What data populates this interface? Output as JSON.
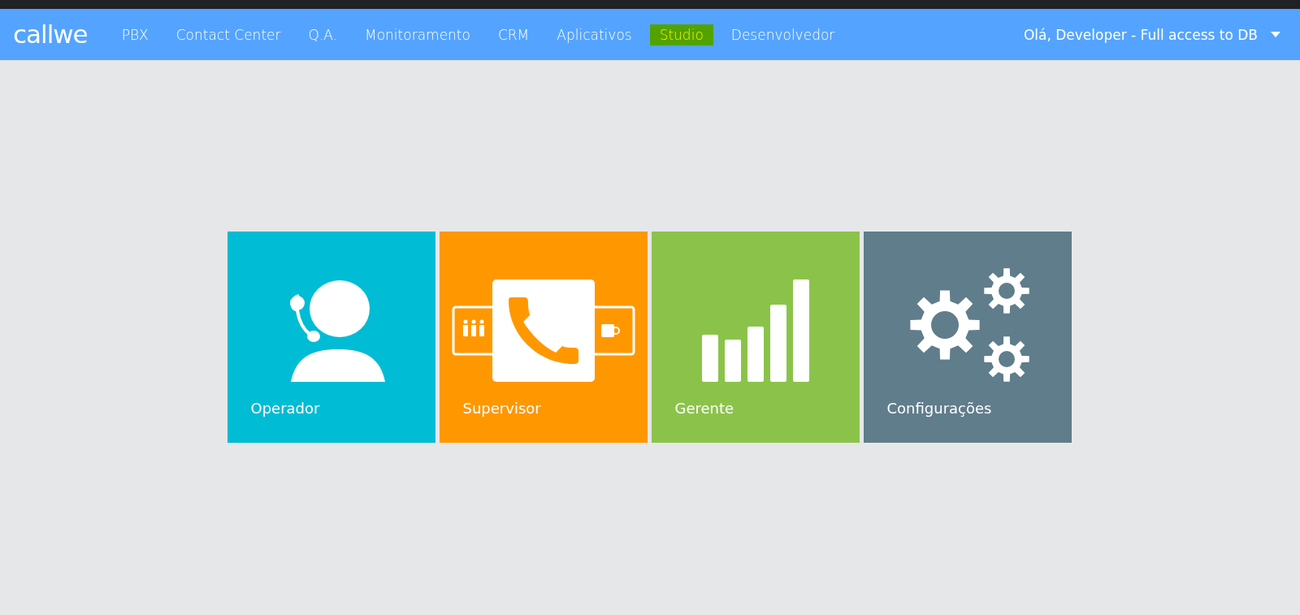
{
  "navbar": {
    "logo": "callwe",
    "items": [
      {
        "label": "PBX",
        "selected": false
      },
      {
        "label": "Contact Center",
        "selected": false
      },
      {
        "label": "Q.A.",
        "selected": false
      },
      {
        "label": "Monitoramento",
        "selected": false
      },
      {
        "label": "CRM",
        "selected": false
      },
      {
        "label": "Aplicativos",
        "selected": false
      },
      {
        "label": "Studio",
        "selected": true
      },
      {
        "label": "Desenvolvedor",
        "selected": false
      }
    ],
    "user_menu": "Olá, Developer - Full access to DB"
  },
  "tiles": [
    {
      "kind": "operator",
      "label": "Operador",
      "color": "#00bcd4"
    },
    {
      "kind": "supervisor",
      "label": "Supervisor",
      "color": "#ff9800"
    },
    {
      "kind": "manager",
      "label": "Gerente",
      "color": "#8bc34a"
    },
    {
      "kind": "settings",
      "label": "Configurações",
      "color": "#607d8b"
    }
  ]
}
